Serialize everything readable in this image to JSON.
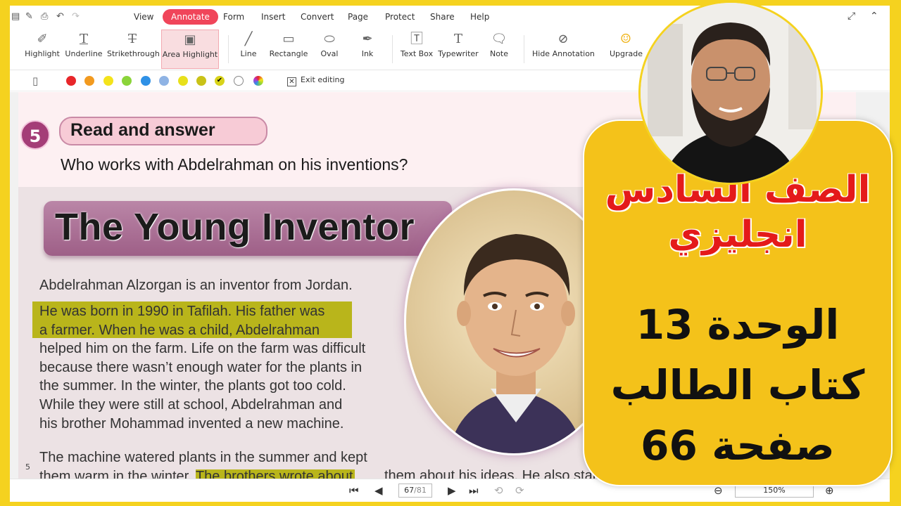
{
  "menu": {
    "items": [
      "View",
      "Annotate",
      "Form",
      "Insert",
      "Convert",
      "Page",
      "Protect",
      "Share",
      "Help"
    ],
    "active": "Annotate"
  },
  "toolbar": {
    "tools": [
      {
        "label": "Highlight",
        "icon": "highlighter-icon"
      },
      {
        "label": "Underline",
        "icon": "underline-icon"
      },
      {
        "label": "Strikethrough",
        "icon": "strikethrough-icon"
      },
      {
        "label": "Area Highlight",
        "icon": "area-highlight-icon"
      },
      {
        "label": "Line",
        "icon": "line-icon"
      },
      {
        "label": "Rectangle",
        "icon": "rectangle-icon"
      },
      {
        "label": "Oval",
        "icon": "oval-icon"
      },
      {
        "label": "Ink",
        "icon": "ink-pen-icon"
      },
      {
        "label": "Text Box",
        "icon": "text-box-icon"
      },
      {
        "label": "Typewriter",
        "icon": "typewriter-icon"
      },
      {
        "label": "Note",
        "icon": "note-icon"
      },
      {
        "label": "Hide Annotation",
        "icon": "hide-annotation-icon"
      },
      {
        "label": "Upgrade",
        "icon": "upgrade-icon"
      }
    ],
    "active_tool": "Area Highlight"
  },
  "colors": {
    "swatches": [
      "#e8262a",
      "#f29a1f",
      "#f4e31b",
      "#8bd43a",
      "#2f91e6",
      "#8fb3e4",
      "#e8e01b",
      "#c9c218",
      "#d8d31a",
      "#ffffff",
      "rainbow"
    ],
    "selected_index": 8,
    "exit_editing": "Exit editing"
  },
  "page": {
    "question_number": "5",
    "question_title": "Read and answer",
    "question_text": "Who works with Abdelrahman on his inventions?",
    "story_title": "The Young Inventor",
    "paragraphs": [
      [
        "Abdelrahman Alzorgan is an inventor from Jordan."
      ],
      [
        "He was born in 1990 in Tafilah. His father was",
        "a farmer. When he was a child, Abdelrahman",
        "helped him on the farm. Life on the farm was difficult",
        "because there wasn’t enough water for the plants in",
        "the summer. In the winter, the plants got too cold."
      ],
      [
        "While they were still at school, Abdelrahman and",
        "his brother Mohammad invented a new machine."
      ],
      [
        "The machine watered plants in the summer and kept",
        "them warm in the winter. The brothers wrote about",
        "them about his ideas. He also started"
      ]
    ],
    "line_number": "5"
  },
  "navigation": {
    "current_page": "67",
    "total_pages": "/81",
    "zoom": "150%"
  },
  "overlay": {
    "lines": [
      "الصف السادس",
      "انجليزي",
      "الوحدة 13",
      "كتاب الطالب",
      "صفحة 66"
    ]
  }
}
